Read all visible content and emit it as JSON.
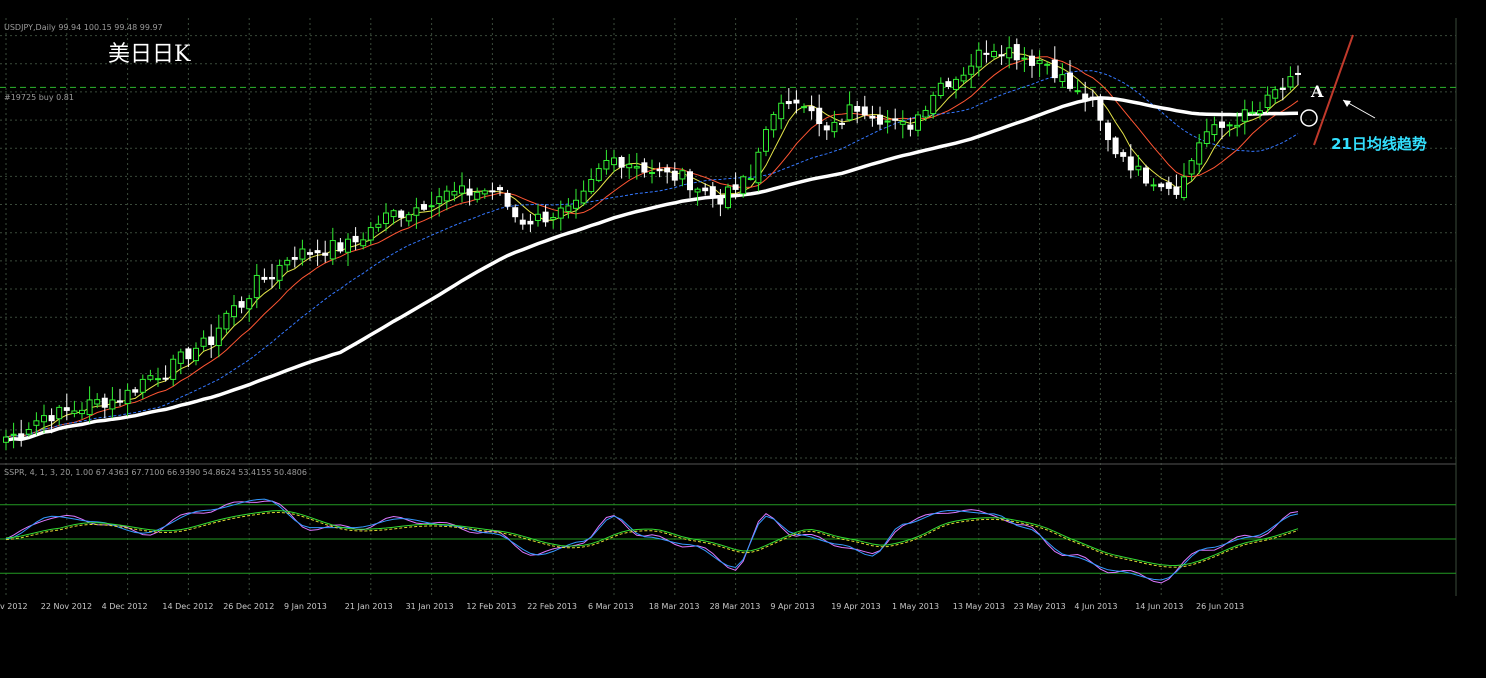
{
  "chart_data": {
    "type": "candlestick",
    "title": "美日日K",
    "symbol_header": "USDJPY,Daily  99.94 100.15 99.48 99.97",
    "level_label": "#19725 buy 0.81",
    "oscillator_header": "SSPR, 4, 1, 3, 20, 1.00 67.4363 67.7100 66.9390 54.8624 53.4155 50.4806",
    "annotations": [
      "A",
      "21日均线趋势"
    ],
    "x_tick_labels": [
      "v 2012",
      "22 Nov 2012",
      "4 Dec 2012",
      "14 Dec 2012",
      "26 Dec 2012",
      "9 Jan 2013",
      "21 Jan 2013",
      "31 Jan 2013",
      "12 Feb 2013",
      "22 Feb 2013",
      "6 Mar 2013",
      "18 Mar 2013",
      "28 Mar 2013",
      "9 Apr 2013",
      "19 Apr 2013",
      "1 May 2013",
      "13 May 2013",
      "23 May 2013",
      "4 Jun 2013",
      "14 Jun 2013",
      "26 Jun 2013"
    ],
    "x_tick_index": [
      0,
      8,
      16,
      24,
      32,
      40,
      48,
      56,
      64,
      72,
      80,
      88,
      96,
      104,
      112,
      120,
      128,
      136,
      144,
      152,
      160
    ],
    "price_anchors": [
      [
        0,
        80.2
      ],
      [
        6,
        81.5
      ],
      [
        14,
        82.3
      ],
      [
        20,
        83.8
      ],
      [
        26,
        85.4
      ],
      [
        30,
        87.5
      ],
      [
        34,
        89.2
      ],
      [
        38,
        90.6
      ],
      [
        44,
        91.0
      ],
      [
        52,
        93.0
      ],
      [
        58,
        94.0
      ],
      [
        64,
        94.2
      ],
      [
        68,
        92.5
      ],
      [
        74,
        93.0
      ],
      [
        80,
        96.0
      ],
      [
        88,
        95.0
      ],
      [
        94,
        93.8
      ],
      [
        98,
        94.8
      ],
      [
        100,
        98.0
      ],
      [
        104,
        99.6
      ],
      [
        108,
        97.5
      ],
      [
        112,
        99.0
      ],
      [
        118,
        97.8
      ],
      [
        124,
        100.5
      ],
      [
        130,
        102.4
      ],
      [
        136,
        101.6
      ],
      [
        142,
        99.5
      ],
      [
        146,
        96.5
      ],
      [
        150,
        95.0
      ],
      [
        154,
        94.4
      ],
      [
        158,
        97.5
      ],
      [
        164,
        98.5
      ],
      [
        168,
        100.0
      ],
      [
        170,
        100.5
      ]
    ],
    "oscillator_anchors": [
      [
        0,
        50
      ],
      [
        6,
        70
      ],
      [
        12,
        65
      ],
      [
        18,
        55
      ],
      [
        26,
        75
      ],
      [
        34,
        85
      ],
      [
        40,
        60
      ],
      [
        46,
        60
      ],
      [
        52,
        68
      ],
      [
        58,
        62
      ],
      [
        64,
        55
      ],
      [
        70,
        36
      ],
      [
        76,
        48
      ],
      [
        80,
        70
      ],
      [
        84,
        52
      ],
      [
        90,
        45
      ],
      [
        96,
        25
      ],
      [
        100,
        70
      ],
      [
        104,
        54
      ],
      [
        110,
        45
      ],
      [
        114,
        35
      ],
      [
        118,
        63
      ],
      [
        124,
        75
      ],
      [
        130,
        72
      ],
      [
        134,
        60
      ],
      [
        140,
        35
      ],
      [
        146,
        22
      ],
      [
        152,
        14
      ],
      [
        158,
        42
      ],
      [
        164,
        52
      ],
      [
        170,
        72
      ]
    ],
    "n_bars": 171,
    "price_ylim": [
      79.0,
      104.0
    ],
    "osc_ylim": [
      0,
      100
    ],
    "osc_levels": [
      80,
      50,
      20
    ],
    "dashed_level": 100.06,
    "legend": "none",
    "grid": true,
    "colors": {
      "background": "#000000",
      "bull_candle": "#33ee33",
      "bear_candle": "#ffffff",
      "ma_fast": "#e6e64a",
      "ma_mid": "#ff5533",
      "ma_slow": "#3377ff",
      "ma_long": "#ffffff",
      "grid": "#3a4a3a",
      "level_line": "#2db82d",
      "trend_line": "#c0392b",
      "annotation_cyan": "#33e0ff",
      "osc_main": "#3399ff",
      "osc_main2": "#dd77ff",
      "osc_signal": "#dddd33",
      "osc_signal2": "#33dd33",
      "osc_level": "#229922"
    }
  }
}
